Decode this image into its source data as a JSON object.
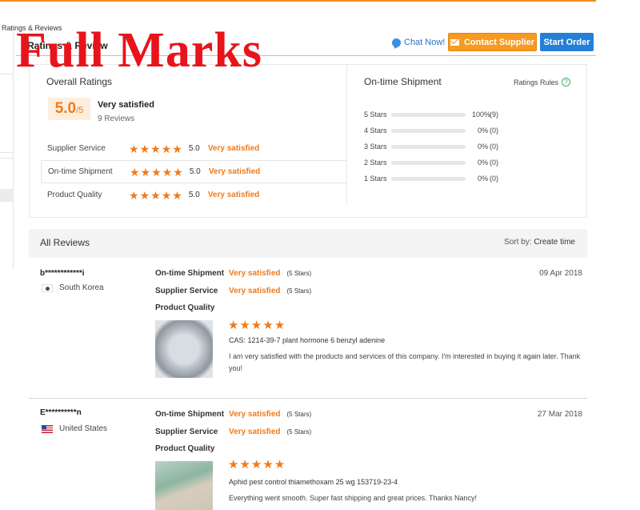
{
  "breadcrumb": "Ratings & Reviews",
  "tab_title": "Ratings & Review",
  "watermark": "Full Marks",
  "actions": {
    "chat": "Chat Now!",
    "contact": "Contact Supplier",
    "start": "Start Order"
  },
  "overall": {
    "title": "Overall Ratings",
    "score": "5.0",
    "out_of": "/5",
    "label": "Very satisfied",
    "count": "9 Reviews"
  },
  "categories": [
    {
      "name": "Supplier Service",
      "score": "5.0",
      "text": "Very satisfied",
      "stars": 5
    },
    {
      "name": "On-time Shipment",
      "score": "5.0",
      "text": "Very satisfied",
      "stars": 5
    },
    {
      "name": "Product Quality",
      "score": "5.0",
      "text": "Very satisfied",
      "stars": 5
    }
  ],
  "ontime": {
    "title": "On-time Shipment",
    "rules": "Ratings Rules",
    "rows": [
      {
        "label": "5 Stars",
        "pct": "100%",
        "count": "(9)",
        "fill": 1.0
      },
      {
        "label": "4 Stars",
        "pct": "0%",
        "count": "(0)",
        "fill": 0
      },
      {
        "label": "3 Stars",
        "pct": "0%",
        "count": "(0)",
        "fill": 0
      },
      {
        "label": "2 Stars",
        "pct": "0%",
        "count": "(0)",
        "fill": 0
      },
      {
        "label": "1 Stars",
        "pct": "0%",
        "count": "(0)",
        "fill": 0
      }
    ]
  },
  "reviews_header": {
    "title": "All Reviews",
    "sort_label": "Sort by:",
    "sort_value": "Create time"
  },
  "reviews": [
    {
      "user": "b************i",
      "country": "South Korea",
      "date": "09 Apr 2018",
      "ontime_label": "On-time Shipment",
      "ontime_value": "Very satisfied",
      "ontime_sub": "(5 Stars)",
      "service_label": "Supplier Service",
      "service_value": "Very satisfied",
      "service_sub": "(5 Stars)",
      "quality_label": "Product Quality",
      "product": "CAS: 1214-39-7 plant hormone 6 benzyl adenine",
      "comment": "I am very satisfied with the products and services of this company. I'm interested in buying it again later. Thank you!"
    },
    {
      "user": "E**********n",
      "country": "United States",
      "date": "27 Mar 2018",
      "ontime_label": "On-time Shipment",
      "ontime_value": "Very satisfied",
      "ontime_sub": "(5 Stars)",
      "service_label": "Supplier Service",
      "service_value": "Very satisfied",
      "service_sub": "(5 Stars)",
      "quality_label": "Product Quality",
      "product": "Aphid pest control thiamethoxam 25 wg 153719-23-4",
      "comment": "Everything went smooth. Super fast shipping and great prices. Thanks Nancy!"
    }
  ],
  "colors": {
    "accent": "#f07a1a",
    "contact_button": "#f79a1f",
    "start_button": "#2480d6",
    "watermark": "#e8141b"
  }
}
